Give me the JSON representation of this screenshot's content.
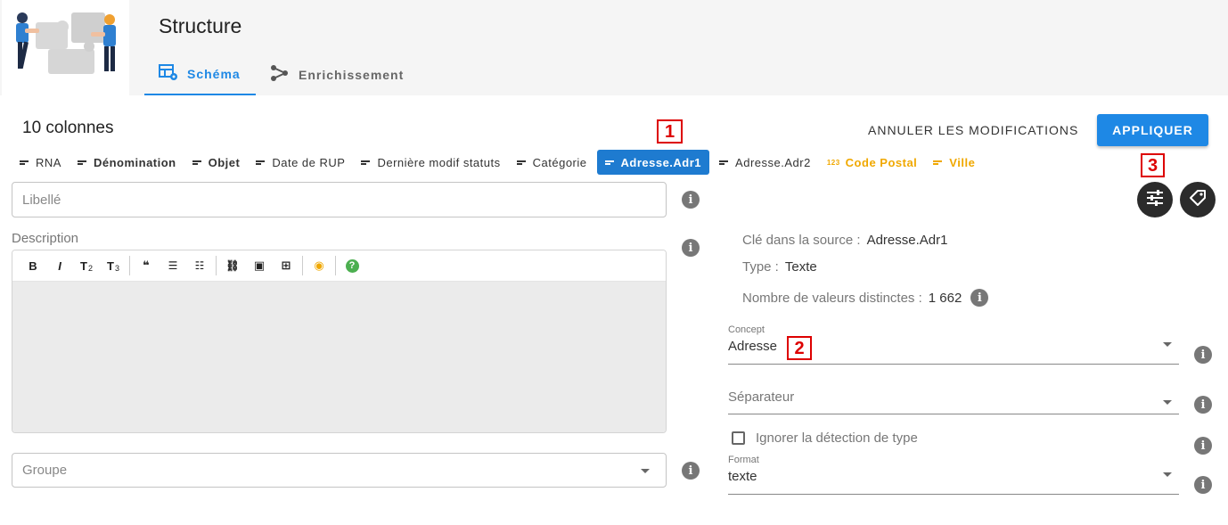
{
  "header": {
    "title": "Structure",
    "tabs": [
      {
        "label": "Schéma",
        "icon": "table-gear-icon",
        "active": true
      },
      {
        "label": "Enrichissement",
        "icon": "graph-nodes-icon",
        "active": false
      }
    ],
    "illustration": "puzzle-people-illustration"
  },
  "toolbar": {
    "column_count": "10 colonnes",
    "cancel_label": "ANNULER LES MODIFICATIONS",
    "apply_label": "APPLIQUER"
  },
  "columns": [
    {
      "label": "RNA",
      "style": "normal",
      "icon": "text-lines-icon"
    },
    {
      "label": "Dénomination",
      "style": "bold",
      "icon": "text-lines-icon"
    },
    {
      "label": "Objet",
      "style": "bold",
      "icon": "text-lines-icon"
    },
    {
      "label": "Date de RUP",
      "style": "normal",
      "icon": "text-lines-icon"
    },
    {
      "label": "Dernière modif statuts",
      "style": "normal",
      "icon": "text-lines-icon"
    },
    {
      "label": "Catégorie",
      "style": "normal",
      "icon": "text-lines-icon"
    },
    {
      "label": "Adresse.Adr1",
      "style": "active",
      "icon": "text-lines-icon"
    },
    {
      "label": "Adresse.Adr2",
      "style": "normal",
      "icon": "text-lines-icon"
    },
    {
      "label": "Code Postal",
      "style": "orange",
      "icon": "number-icon",
      "icon_text": "123"
    },
    {
      "label": "Ville",
      "style": "orange",
      "icon": "text-lines-icon"
    }
  ],
  "markers": [
    "1",
    "2",
    "3"
  ],
  "form": {
    "libelle_placeholder": "Libellé",
    "description_label": "Description",
    "editor_tools": [
      {
        "name": "bold-icon",
        "glyph": "B"
      },
      {
        "name": "italic-icon",
        "glyph": "I"
      },
      {
        "name": "heading-2-icon",
        "glyph": "T",
        "sub": "2"
      },
      {
        "name": "heading-3-icon",
        "glyph": "T",
        "sub": "3"
      },
      {
        "name": "quote-icon",
        "glyph": "❝"
      },
      {
        "name": "bullet-list-icon",
        "glyph": "☰"
      },
      {
        "name": "numbered-list-icon",
        "glyph": "☷"
      },
      {
        "name": "link-icon",
        "glyph": "⛓"
      },
      {
        "name": "image-icon",
        "glyph": "▣"
      },
      {
        "name": "table-icon",
        "glyph": "⊞"
      },
      {
        "name": "preview-eye-icon",
        "glyph": "◉"
      },
      {
        "name": "help-icon",
        "glyph": "?"
      }
    ],
    "groupe_placeholder": "Groupe"
  },
  "details": {
    "source_key_label": "Clé dans la source :",
    "source_key_value": "Adresse.Adr1",
    "type_label": "Type :",
    "type_value": "Texte",
    "distinct_label": "Nombre de valeurs distinctes :",
    "distinct_value": "1 662",
    "concept_label": "Concept",
    "concept_value": "Adresse",
    "separator_placeholder": "Séparateur",
    "ignore_label": "Ignorer la détection de type",
    "format_label": "Format",
    "format_value": "texte"
  },
  "colors": {
    "accent": "#1e88e5",
    "active_chip": "#1e7bd0",
    "orange": "#f0a800",
    "marker": "#dd0000"
  }
}
